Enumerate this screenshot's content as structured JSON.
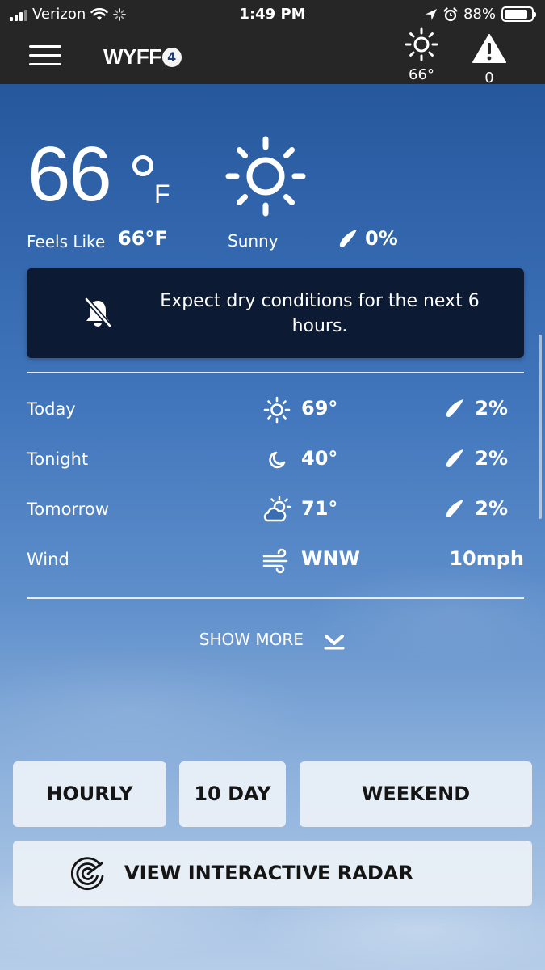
{
  "status_bar": {
    "carrier": "Verizon",
    "time": "1:49 PM",
    "battery_percent": "88%",
    "battery_level": 0.88
  },
  "header": {
    "logo_text": "WYFF",
    "logo_badge": "4",
    "current_temp_small": "66°",
    "alert_count": "0",
    "icons": [
      "menu-icon",
      "sun-icon",
      "warning-icon"
    ]
  },
  "current": {
    "temperature": "66",
    "unit": "F",
    "feels_like_label": "Feels Like",
    "feels_like_value": "66°F",
    "condition": "Sunny",
    "precip": "0%"
  },
  "alert": {
    "message": "Expect dry conditions for the next 6 hours."
  },
  "forecast": [
    {
      "label": "Today",
      "icon": "sun-icon",
      "temp": "69°",
      "precip": "2%"
    },
    {
      "label": "Tonight",
      "icon": "moon-icon",
      "temp": "40°",
      "precip": "2%"
    },
    {
      "label": "Tomorrow",
      "icon": "partly-cloudy-icon",
      "temp": "71°",
      "precip": "2%"
    }
  ],
  "wind": {
    "label": "Wind",
    "icon": "wind-icon",
    "direction": "WNW",
    "speed": "10mph"
  },
  "show_more": "SHOW MORE",
  "buttons": {
    "hourly": "HOURLY",
    "ten_day": "10 DAY",
    "weekend": "WEEKEND",
    "radar": "VIEW INTERACTIVE RADAR"
  }
}
